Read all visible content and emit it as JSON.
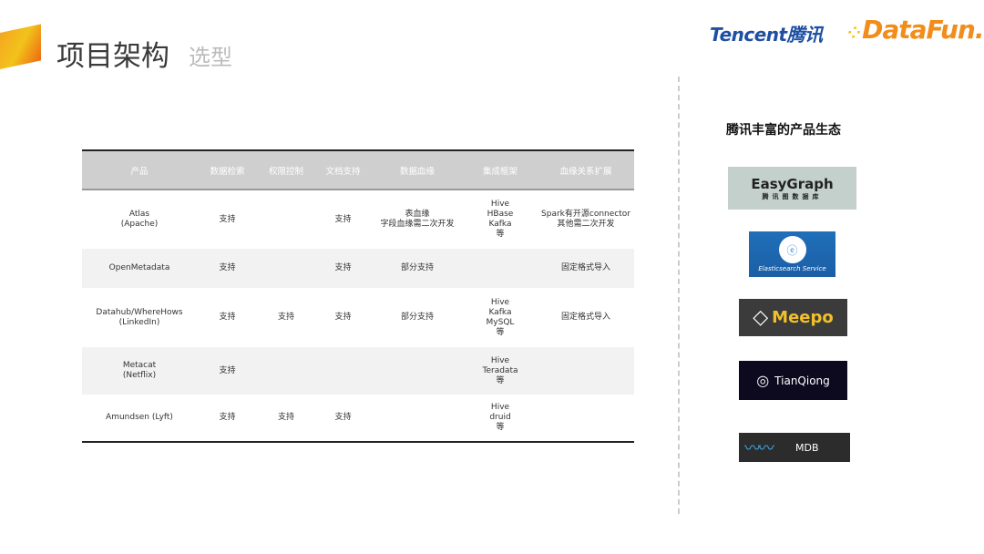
{
  "header": {
    "title": "项目架构",
    "subtitle": "选型"
  },
  "brand": {
    "tencent": "Tencent腾讯",
    "datafun": "DataFun."
  },
  "table": {
    "columns": [
      "产品",
      "数据检索",
      "权限控制",
      "文档支持",
      "数据血缘",
      "集成框架",
      "血缘关系扩展"
    ],
    "rows": [
      {
        "product": [
          "Atlas",
          "(Apache)"
        ],
        "search": "支持",
        "auth": "",
        "docs": "支持",
        "lineage": [
          "表血缘",
          "字段血缘需二次开发"
        ],
        "integration": [
          "Hive",
          "HBase",
          "Kafka",
          "等"
        ],
        "extension": [
          "Spark有开源connector",
          "其他需二次开发"
        ]
      },
      {
        "product": [
          "OpenMetadata"
        ],
        "search": "支持",
        "auth": "",
        "docs": "支持",
        "lineage": [
          "部分支持"
        ],
        "integration": [],
        "extension": [
          "固定格式导入"
        ]
      },
      {
        "product": [
          "Datahub/WhereHows",
          "(LinkedIn)"
        ],
        "search": "支持",
        "auth": "支持",
        "docs": "支持",
        "lineage": [
          "部分支持"
        ],
        "integration": [
          "Hive",
          "Kafka",
          "MySQL",
          "等"
        ],
        "extension": [
          "固定格式导入"
        ]
      },
      {
        "product": [
          "Metacat",
          "(Netflix)"
        ],
        "search": "支持",
        "auth": "",
        "docs": "",
        "lineage": [],
        "integration": [
          "Hive",
          "Teradata",
          "等"
        ],
        "extension": []
      },
      {
        "product": [
          "Amundsen (Lyft)"
        ],
        "search": "支持",
        "auth": "支持",
        "docs": "支持",
        "lineage": [],
        "integration": [
          "Hive",
          "druid",
          "等"
        ],
        "extension": []
      }
    ]
  },
  "ecosystem": {
    "title": "腾讯丰富的产品生态",
    "logos": {
      "easygraph": "EasyGraph",
      "easygraph_sub": "腾讯图数据库",
      "es": "Elasticsearch Service",
      "meepo": "Meepo",
      "tianqiong": "TianQiong",
      "mdb": "MDB"
    }
  }
}
